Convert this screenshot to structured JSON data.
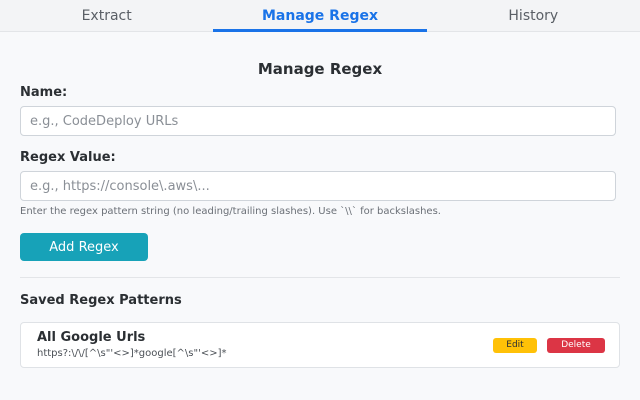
{
  "tabs": [
    {
      "label": "Extract",
      "active": false
    },
    {
      "label": "Manage Regex",
      "active": true
    },
    {
      "label": "History",
      "active": false
    }
  ],
  "form": {
    "title": "Manage Regex",
    "name_label": "Name:",
    "name_placeholder": "e.g., CodeDeploy URLs",
    "regex_label": "Regex Value:",
    "regex_placeholder": "e.g., https://console\\.aws\\...",
    "help_text": "Enter the regex pattern string (no leading/trailing slashes). Use `\\\\` for backslashes.",
    "add_button_label": "Add Regex"
  },
  "saved": {
    "section_title": "Saved Regex Patterns",
    "items": [
      {
        "name": "All Google Urls",
        "pattern": "https?:\\/\\/[^\\s\"'<>]*google[^\\s\"'<>]*",
        "edit_label": "Edit",
        "delete_label": "Delete"
      }
    ]
  },
  "colors": {
    "accent": "#1a73e8",
    "add_button": "#17a2b8",
    "edit_button": "#ffc107",
    "delete_button": "#dc3545"
  }
}
